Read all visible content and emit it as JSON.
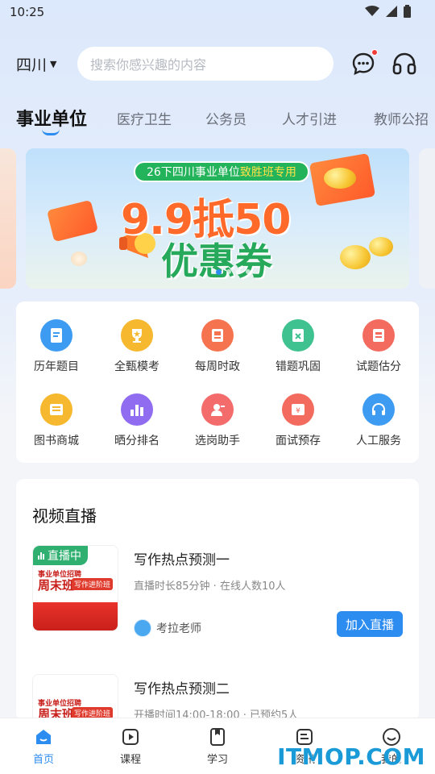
{
  "status_bar": {
    "time": "10:25"
  },
  "header": {
    "region": "四川",
    "search_placeholder": "搜索你感兴趣的内容"
  },
  "tabs": [
    {
      "label": "事业单位",
      "active": true
    },
    {
      "label": "医疗卫生",
      "active": false
    },
    {
      "label": "公务员",
      "active": false
    },
    {
      "label": "人才引进",
      "active": false
    },
    {
      "label": "教师公招",
      "active": false
    }
  ],
  "banner": {
    "tag_prefix": "26下四川事业单位",
    "tag_highlight": "致胜班专用",
    "line1": "9.9抵50",
    "line2": "优惠券",
    "page_count": 4,
    "active_page": 1
  },
  "features": [
    {
      "label": "历年题目",
      "color": "#3d9bf2",
      "icon": "document-icon"
    },
    {
      "label": "全甄模考",
      "color": "#f5b82e",
      "icon": "trophy-icon"
    },
    {
      "label": "每周时政",
      "color": "#f5734e",
      "icon": "book-icon"
    },
    {
      "label": "错题巩固",
      "color": "#3fc28f",
      "icon": "error-book-icon"
    },
    {
      "label": "试题估分",
      "color": "#f36b5e",
      "icon": "score-icon"
    },
    {
      "label": "图书商城",
      "color": "#f5b82e",
      "icon": "bookstore-icon"
    },
    {
      "label": "晒分排名",
      "color": "#8f6cf0",
      "icon": "ranking-icon"
    },
    {
      "label": "选岗助手",
      "color": "#f36b6b",
      "icon": "assistant-icon"
    },
    {
      "label": "面试预存",
      "color": "#f36b5e",
      "icon": "ticket-icon"
    },
    {
      "label": "人工服务",
      "color": "#3d9bf2",
      "icon": "headset-icon"
    }
  ],
  "live_section": {
    "title": "视频直播",
    "items": [
      {
        "badge": "直播中",
        "thumb_line1": "事业单位招聘",
        "thumb_line2": "周末班",
        "thumb_tag": "写作进阶班",
        "title": "写作热点预测一",
        "meta": "直播时长85分钟 · 在线人数10人",
        "teacher": "考拉老师",
        "button": "加入直播"
      },
      {
        "badge": "",
        "thumb_line1": "事业单位招聘",
        "thumb_line2": "周末班",
        "thumb_tag": "写作进阶班",
        "title": "写作热点预测二",
        "meta": "开播时间14:00-18:00 · 已预约5人"
      }
    ]
  },
  "bottom_nav": [
    {
      "label": "首页",
      "active": true,
      "icon": "home-icon"
    },
    {
      "label": "课程",
      "active": false,
      "icon": "course-icon"
    },
    {
      "label": "学习",
      "active": false,
      "icon": "study-icon"
    },
    {
      "label": "资讯",
      "active": false,
      "icon": "news-icon"
    },
    {
      "label": "我的",
      "active": false,
      "icon": "profile-icon"
    }
  ],
  "watermark": "ITMOP.COM",
  "colors": {
    "accent": "#2d8cf0",
    "live_green": "#2fb070"
  }
}
